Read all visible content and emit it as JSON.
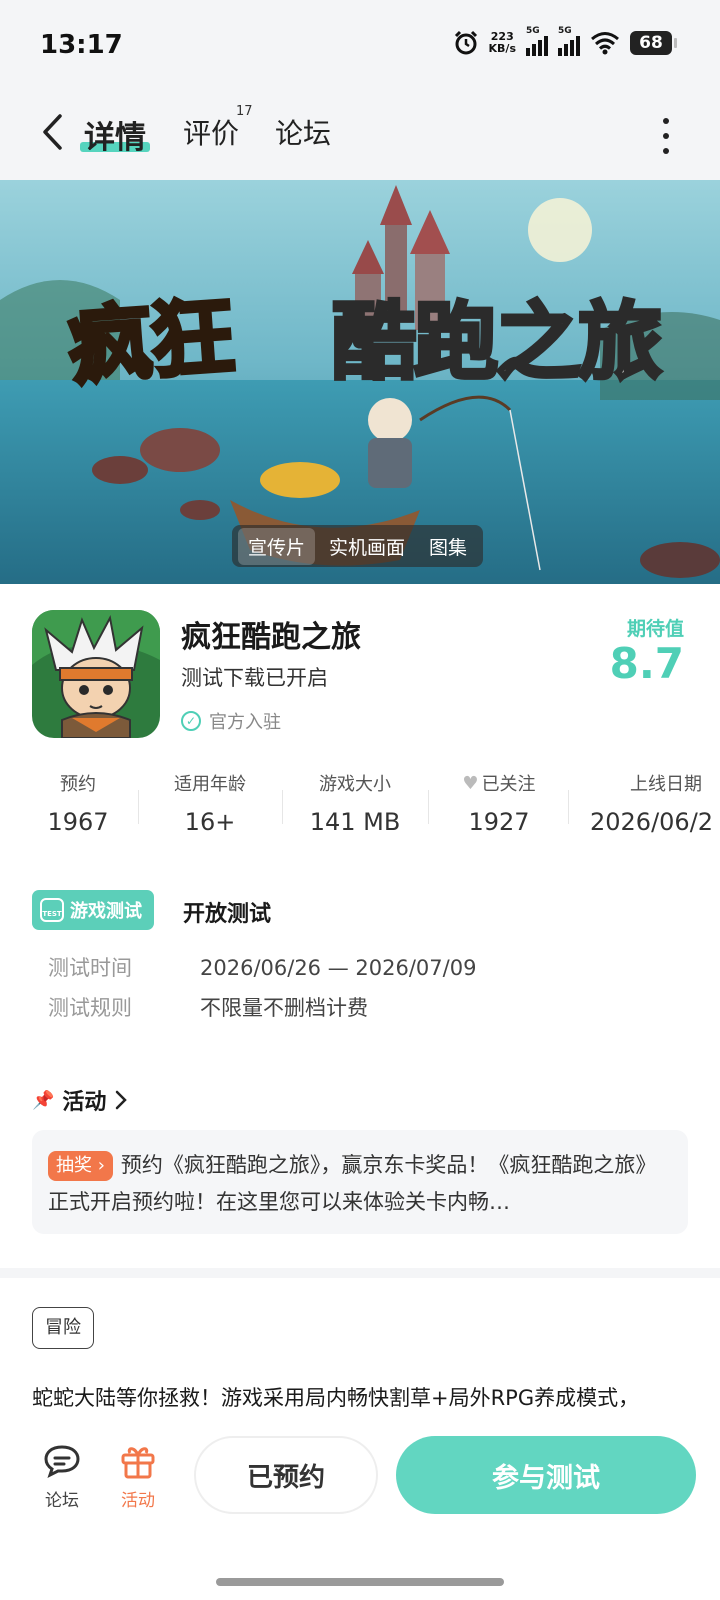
{
  "status_bar": {
    "time": "13:17",
    "net_speed_value": "223",
    "net_speed_unit": "KB/s",
    "sim1": "5G",
    "sim2": "5G",
    "battery": "68"
  },
  "nav": {
    "tab_detail": "详情",
    "tab_review": "评价",
    "review_count": "17",
    "tab_forum": "论坛"
  },
  "banner": {
    "title_part1": "疯狂",
    "title_part2": "酷跑之旅",
    "media_tabs": [
      "宣传片",
      "实机画面",
      "图集"
    ]
  },
  "game": {
    "name": "疯狂酷跑之旅",
    "status": "测试下载已开启",
    "official": "官方入驻",
    "expect_label": "期待值",
    "expect_score": "8.7"
  },
  "stats": [
    {
      "label": "预约",
      "value": "1967"
    },
    {
      "label": "适用年龄",
      "value": "16+"
    },
    {
      "label": "游戏大小",
      "value": "141 MB"
    },
    {
      "label": "已关注",
      "value": "1927"
    },
    {
      "label": "上线日期",
      "value": "2026/06/2"
    }
  ],
  "test": {
    "badge": "游戏测试",
    "badge_icon_text": "TEST",
    "type": "开放测试",
    "time_label": "测试时间",
    "time_value": "2026/06/26 — 2026/07/09",
    "rule_label": "测试规则",
    "rule_value": "不限量不删档计费"
  },
  "activity": {
    "title": "活动",
    "tag": "抽奖",
    "text": "预约《疯狂酷跑之旅》，赢京东卡奖品！《疯狂酷跑之旅》正式开启预约啦！在这里您可以来体验关卡内畅…"
  },
  "genre": "冒险",
  "description": "蛇蛇大陆等你拯救！游戏采用局内畅快割草+局外RPG养成模式，Roguelike元素与策略搭配结合合而玩，结合封游特色内容",
  "bottom_bar": {
    "forum": "论坛",
    "activity": "活动",
    "reserved": "已预约",
    "join": "参与测试"
  },
  "colors": {
    "accent": "#5ccfb9",
    "orange": "#f2774a"
  }
}
